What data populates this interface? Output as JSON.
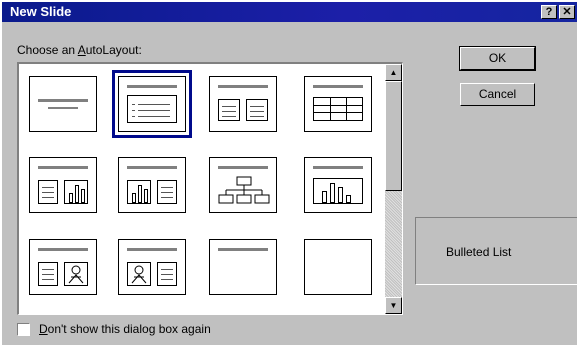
{
  "window": {
    "title": "New Slide",
    "help_label": "?",
    "close_label": "✕"
  },
  "gallery": {
    "label_prefix": "Choose an ",
    "label_accel": "A",
    "label_suffix": "utoLayout:",
    "selected_index": 1,
    "layouts": [
      {
        "name": "title-slide"
      },
      {
        "name": "bulleted-list"
      },
      {
        "name": "two-column-text"
      },
      {
        "name": "table"
      },
      {
        "name": "text-and-chart"
      },
      {
        "name": "chart-and-text"
      },
      {
        "name": "organization-chart"
      },
      {
        "name": "chart"
      },
      {
        "name": "text-and-clip-art"
      },
      {
        "name": "clip-art-and-text"
      },
      {
        "name": "title-only"
      },
      {
        "name": "blank"
      }
    ]
  },
  "buttons": {
    "ok": "OK",
    "cancel": "Cancel"
  },
  "preview": {
    "label": "Bulleted List"
  },
  "checkbox": {
    "accel": "D",
    "label_rest": "on't show this dialog box again",
    "checked": false
  },
  "colors": {
    "titlebar": "#0a1a8c",
    "selection": "#000a8c",
    "face": "#c0c0c0"
  }
}
